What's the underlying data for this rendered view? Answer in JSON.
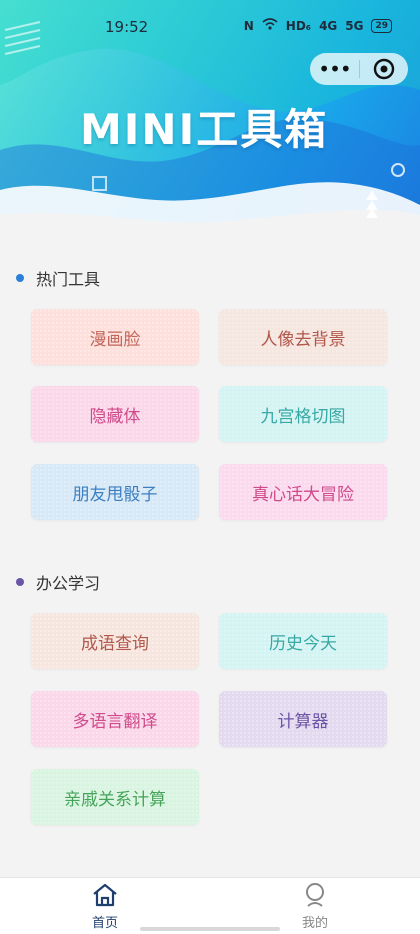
{
  "status_bar": {
    "time": "19:52",
    "network": "HD₆",
    "signal1": "4G",
    "signal2": "5G",
    "battery": "29"
  },
  "header": {
    "title": "MINI工具箱"
  },
  "sections": [
    {
      "title": "热门工具",
      "dot_color": "#2b7fd8"
    },
    {
      "title": "办公学习",
      "dot_color": "#6a55a6"
    }
  ],
  "tools": {
    "hot": [
      {
        "label": "漫画脸",
        "bg": "#fde0dc",
        "fg": "#c2665a"
      },
      {
        "label": "人像去背景",
        "bg": "#f5e6e0",
        "fg": "#b2574a"
      },
      {
        "label": "隐藏体",
        "bg": "#fbd7ea",
        "fg": "#cf4a8a"
      },
      {
        "label": "九宫格切图",
        "bg": "#d4f3f3",
        "fg": "#37a9a4"
      },
      {
        "label": "朋友甩骰子",
        "bg": "#d7e8f6",
        "fg": "#3b7fc1"
      },
      {
        "label": "真心话大冒险",
        "bg": "#fbd9ee",
        "fg": "#cf4a8a"
      }
    ],
    "study": [
      {
        "label": "成语查询",
        "bg": "#f6e6df",
        "fg": "#b2574a"
      },
      {
        "label": "历史今天",
        "bg": "#d4f3f3",
        "fg": "#37a9a4"
      },
      {
        "label": "多语言翻译",
        "bg": "#fbd7ea",
        "fg": "#cf4a8a"
      },
      {
        "label": "计算器",
        "bg": "#e3daef",
        "fg": "#6a55a6"
      },
      {
        "label": "亲戚关系计算",
        "bg": "#d9f5e1",
        "fg": "#46a45a"
      }
    ]
  },
  "tabbar": {
    "home_label": "首页",
    "mine_label": "我的",
    "active_color": "#1e3e6e",
    "inactive_color": "#888888"
  }
}
